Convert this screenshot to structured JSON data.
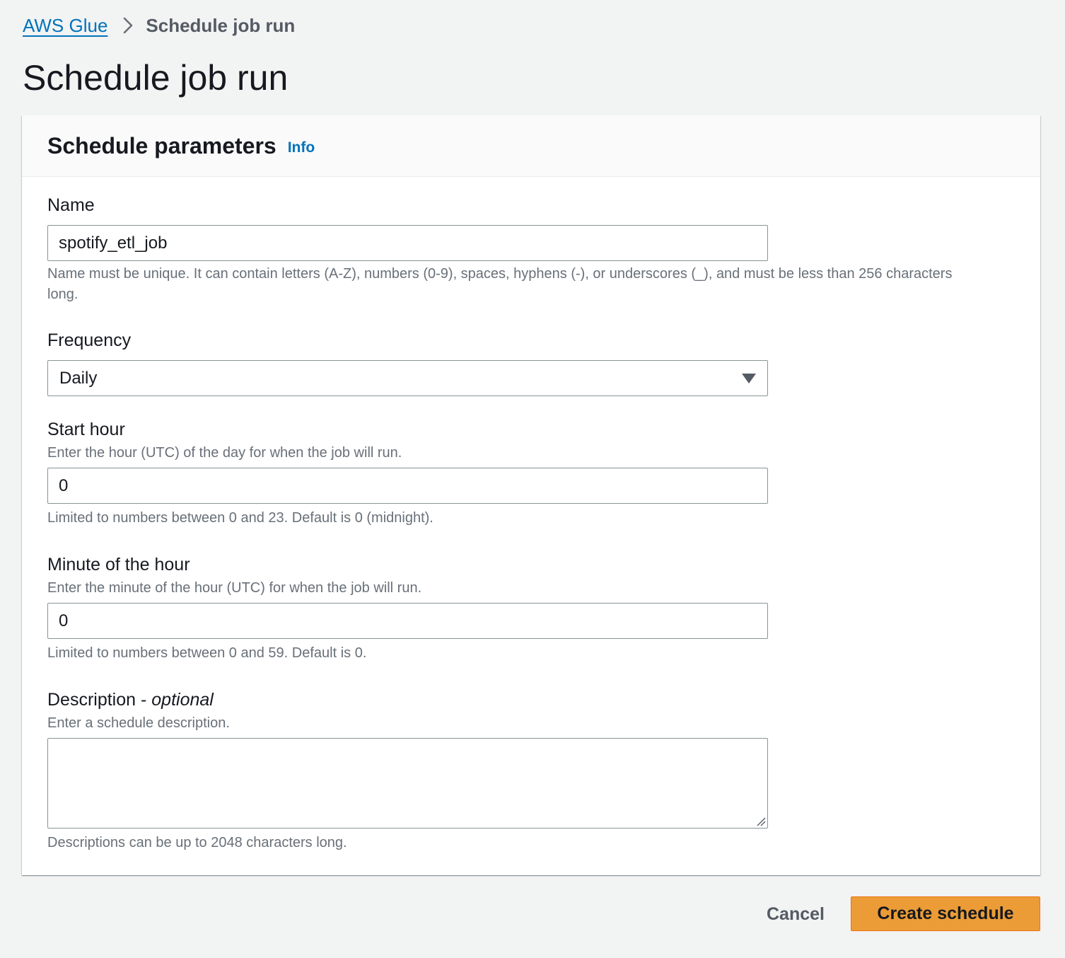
{
  "breadcrumb": {
    "items": [
      {
        "label": "AWS Glue"
      },
      {
        "label": "Schedule job run"
      }
    ],
    "separator_icon": "chevron-right-icon"
  },
  "page": {
    "title": "Schedule job run"
  },
  "panel": {
    "title": "Schedule parameters",
    "info_label": "Info"
  },
  "form": {
    "name": {
      "label": "Name",
      "value": "spotify_etl_job",
      "constraint": "Name must be unique. It can contain letters (A-Z), numbers (0-9), spaces, hyphens (-), or underscores (_), and must be less than 256 characters long."
    },
    "frequency": {
      "label": "Frequency",
      "selected": "Daily",
      "icon": "caret-down-icon"
    },
    "start_hour": {
      "label": "Start hour",
      "description": "Enter the hour (UTC) of the day for when the job will run.",
      "value": "0",
      "constraint": "Limited to numbers between 0 and 23. Default is 0 (midnight)."
    },
    "minute": {
      "label": "Minute of the hour",
      "description": "Enter the minute of the hour (UTC) for when the job will run.",
      "value": "0",
      "constraint": "Limited to numbers between 0 and 59. Default is 0."
    },
    "description": {
      "label": "Description - ",
      "label_optional": "optional",
      "description": "Enter a schedule description.",
      "value": "",
      "constraint": "Descriptions can be up to 2048 characters long."
    }
  },
  "footer": {
    "cancel_label": "Cancel",
    "create_label": "Create schedule"
  },
  "colors": {
    "link": "#0073bb",
    "primary_button": "#ec9c36",
    "background": "#f2f3f3",
    "panel": "#ffffff",
    "border": "#879596",
    "muted_text": "#687078"
  }
}
